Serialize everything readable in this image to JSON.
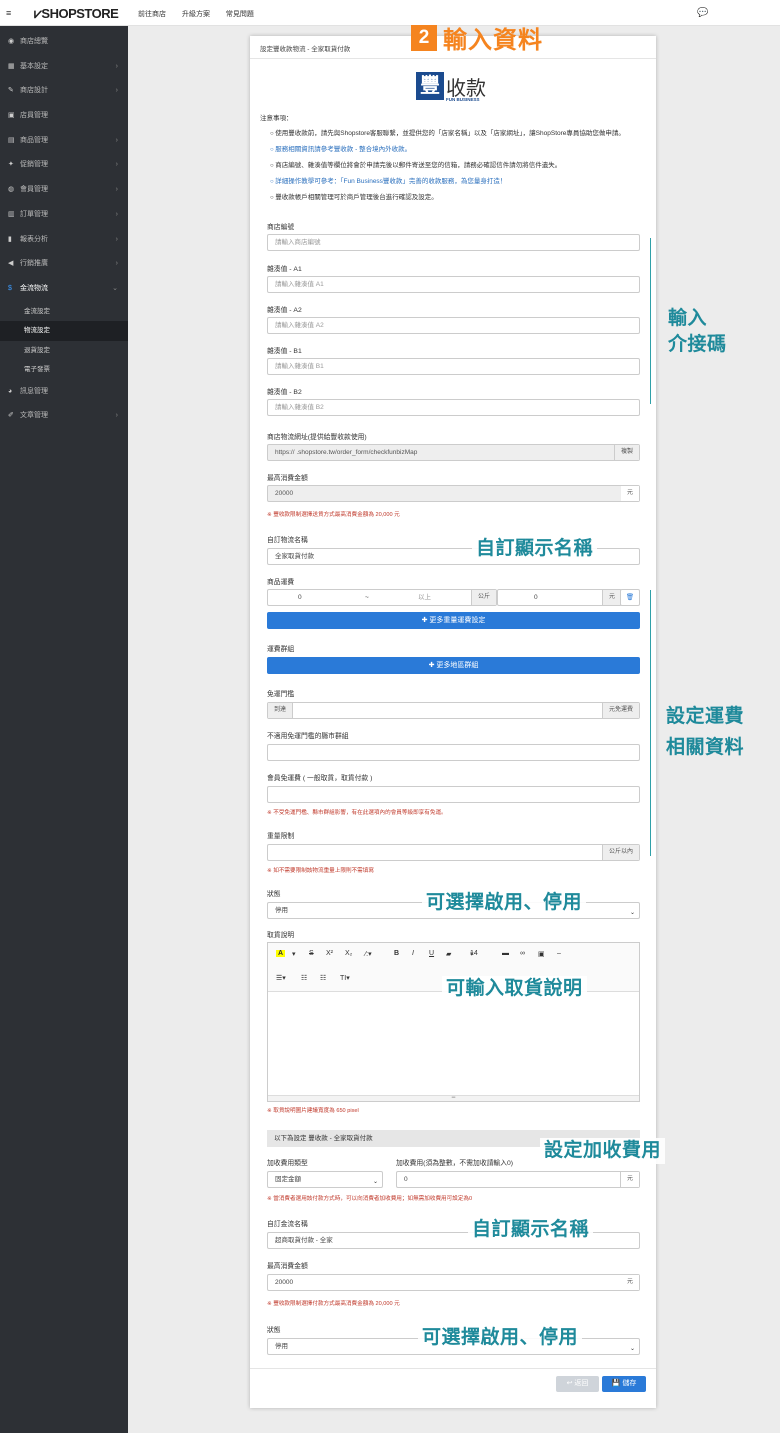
{
  "topbar": {
    "menu_icon": "≡",
    "logo": "SHOPSTORE",
    "nav": [
      "前往商店",
      "升級方案",
      "常見問題"
    ],
    "chat_icon": "💬"
  },
  "sidebar": {
    "items": [
      {
        "icon": "dashboard-icon",
        "glyph": "◉",
        "label": "商店總覽",
        "arrow": ""
      },
      {
        "icon": "bank-icon",
        "glyph": "▦",
        "label": "基本設定",
        "arrow": "›"
      },
      {
        "icon": "wand-icon",
        "glyph": "✎",
        "label": "商店設計",
        "arrow": "›"
      },
      {
        "icon": "store-icon",
        "glyph": "▣",
        "label": "店員管理",
        "arrow": ""
      },
      {
        "icon": "cart-icon",
        "glyph": "▤",
        "label": "商品管理",
        "arrow": "›"
      },
      {
        "icon": "gift-icon",
        "glyph": "✦",
        "label": "促銷管理",
        "arrow": "›"
      },
      {
        "icon": "users-icon",
        "glyph": "◍",
        "label": "會員管理",
        "arrow": "›"
      },
      {
        "icon": "orders-icon",
        "glyph": "▥",
        "label": "訂單管理",
        "arrow": "›"
      },
      {
        "icon": "chart-icon",
        "glyph": "▮",
        "label": "報表分析",
        "arrow": "›"
      },
      {
        "icon": "megaphone-icon",
        "glyph": "◀",
        "label": "行銷推廣",
        "arrow": "›"
      },
      {
        "icon": "dollar-icon",
        "glyph": "$",
        "label": "金流物流",
        "arrow": "⌄"
      }
    ],
    "subitems": [
      "金流設定",
      "物流設定",
      "退貨設定",
      "電子發票"
    ],
    "items_after": [
      {
        "icon": "comments-icon",
        "glyph": "◕",
        "label": "訊息管理",
        "arrow": ""
      },
      {
        "icon": "edit-icon",
        "glyph": "✐",
        "label": "文章管理",
        "arrow": "›"
      }
    ]
  },
  "step": {
    "num": "2",
    "title": "輸入資料"
  },
  "card": {
    "title": "設定豐收款物流 - 全家取貨付款",
    "brand_box": "豐",
    "brand_zh": "收款",
    "brand_en": "FUN BUSINESS",
    "notes_title": "注意事項：",
    "notes": [
      "使用豐收款前，請先與Shopstore客服聯繫，並提供您的「店家名稱」以及「店家網址」，讓ShopStore專員協助您做申請。",
      "服務相關資訊請參考豐收款 - 整合境內外收款。",
      "商店編號、雜湊值等欄位將會於申請完後以郵件寄送至您的信箱，請務必確認信件請勿將信件遺失。",
      "詳細操作教學可參考：「Fun Business豐收款」完善的收款服務，為您量身打造！",
      "豐收款帳戶相關管理可於商戶管理後台進行確認及設定。"
    ],
    "store_id_label": "商店編號",
    "store_id_ph": "請輸入商店編號",
    "a1_label": "雜湊值 - A1",
    "a1_ph": "請輸入雜湊值 A1",
    "a2_label": "雜湊值 - A2",
    "a2_ph": "請輸入雜湊值 A2",
    "b1_label": "雜湊值 - B1",
    "b1_ph": "請輸入雜湊值 B1",
    "b2_label": "雜湊值 - B2",
    "b2_ph": "請輸入雜湊值 B2",
    "map_label": "商店物流網址(提供給豐收款使用)",
    "map_value": "https://          .shopstore.tw/order_form/checkfunbizMap",
    "copy_label": "複製",
    "max_label": "最高消費金額",
    "max_value": "20000",
    "unit_yuan": "元",
    "max_warn": "※ 豐收款限制選擇送貨方式最高消費金額為 20,000 元",
    "custom_name_label": "自訂物流名稱",
    "custom_name_value": "全家取貨付款",
    "shipping_label": "商品運費",
    "ship_from": "0",
    "ship_tilde": "~",
    "ship_above": "以上",
    "ship_kg": "公斤",
    "ship_fee": "0",
    "weight_btn": "✚ 更多重量運費設定",
    "group_label": "運費群組",
    "region_btn": "✚ 更多地區群組",
    "free_label": "免運門檻",
    "free_prefix": "到達",
    "free_suffix": "元免運費",
    "excluded_label": "不適用免運門檻的縣市群組",
    "member_free_label": "會員免運費 ( 一般取貨，取貨付款 )",
    "member_warn": "※ 不受免運門檻、縣市群組影響，有在此選項內的會員等級即享有免運。",
    "weight_label": "重量限制",
    "weight_suffix": "公斤以內",
    "weight_warn": "※ 如不需要限制該物流重量上限則不需填寫",
    "status_label": "狀態",
    "status_value": "停用",
    "desc_label": "取貨說明",
    "desc_warn": "※ 取貨說明圖片建議寬度為 650 pixel",
    "editor_font_size": "14",
    "subhead": "以下為設定 豐收款 - 全家取貨付款",
    "fee_type_label": "加收費用類型",
    "fee_type_value": "固定金額",
    "fee_label": "加收費用(須為整數，不需加收請輸入0)",
    "fee_value": "0",
    "fee_warn": "※ 當消費者選用該付款方式時，可以向消費者加收費用；如無需加收費用可設定為0",
    "pay_name_label": "自訂金流名稱",
    "pay_name_value": "超商取貨付款 - 全家",
    "max2_label": "最高消費金額",
    "max2_value": "20000",
    "max2_warn": "※ 豐收款限制選擇付款方式最高消費金額為 20,000 元",
    "status2_label": "狀態",
    "status2_value": "停用",
    "back_btn": "↩ 返回",
    "save_btn": "💾 儲存"
  },
  "callouts": {
    "c1": "輸入\n介接碼",
    "c2": "自訂顯示名稱",
    "c3": "設定運費\n相關資料",
    "c4": "可選擇啟用、停用",
    "c5": "可輸入取貨說明",
    "c6": "設定加收費用",
    "c7": "自訂顯示名稱",
    "c8": "可選擇啟用、停用"
  },
  "colors": {
    "accent_orange": "#f5841f",
    "callout_teal": "#1f8a9b",
    "button_blue": "#2a7ad8",
    "sidebar_bg": "#2d3035",
    "warn_red": "#c0392b"
  }
}
